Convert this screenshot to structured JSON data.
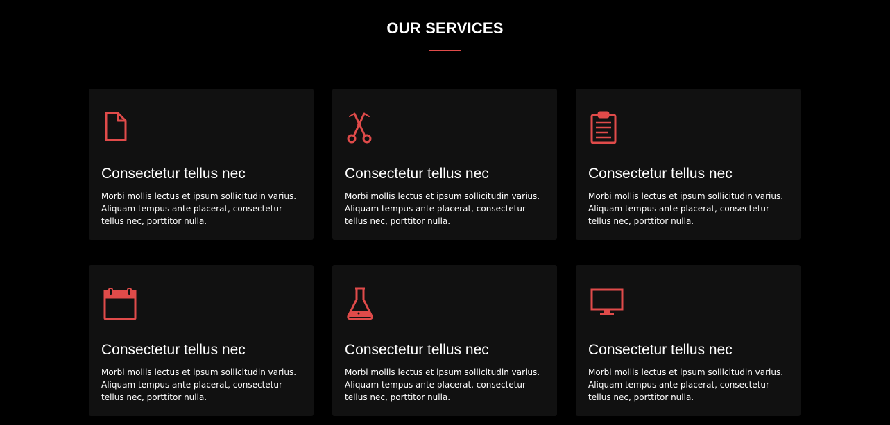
{
  "section": {
    "title": "OUR SERVICES",
    "accent_color": "#e04b4a"
  },
  "services": [
    {
      "icon": "document-icon",
      "title": "Consectetur tellus nec",
      "text": "Morbi mollis lectus et ipsum sollicitudin varius. Aliquam tempus ante placerat, consectetur tellus nec, porttitor nulla."
    },
    {
      "icon": "scissors-icon",
      "title": "Consectetur tellus nec",
      "text": "Morbi mollis lectus et ipsum sollicitudin varius. Aliquam tempus ante placerat, consectetur tellus nec, porttitor nulla."
    },
    {
      "icon": "clipboard-icon",
      "title": "Consectetur tellus nec",
      "text": "Morbi mollis lectus et ipsum sollicitudin varius. Aliquam tempus ante placerat, consectetur tellus nec, porttitor nulla."
    },
    {
      "icon": "calendar-icon",
      "title": "Consectetur tellus nec",
      "text": "Morbi mollis lectus et ipsum sollicitudin varius. Aliquam tempus ante placerat, consectetur tellus nec, porttitor nulla."
    },
    {
      "icon": "flask-icon",
      "title": "Consectetur tellus nec",
      "text": "Morbi mollis lectus et ipsum sollicitudin varius. Aliquam tempus ante placerat, consectetur tellus nec, porttitor nulla."
    },
    {
      "icon": "monitor-icon",
      "title": "Consectetur tellus nec",
      "text": "Morbi mollis lectus et ipsum sollicitudin varius. Aliquam tempus ante placerat, consectetur tellus nec, porttitor nulla."
    }
  ]
}
